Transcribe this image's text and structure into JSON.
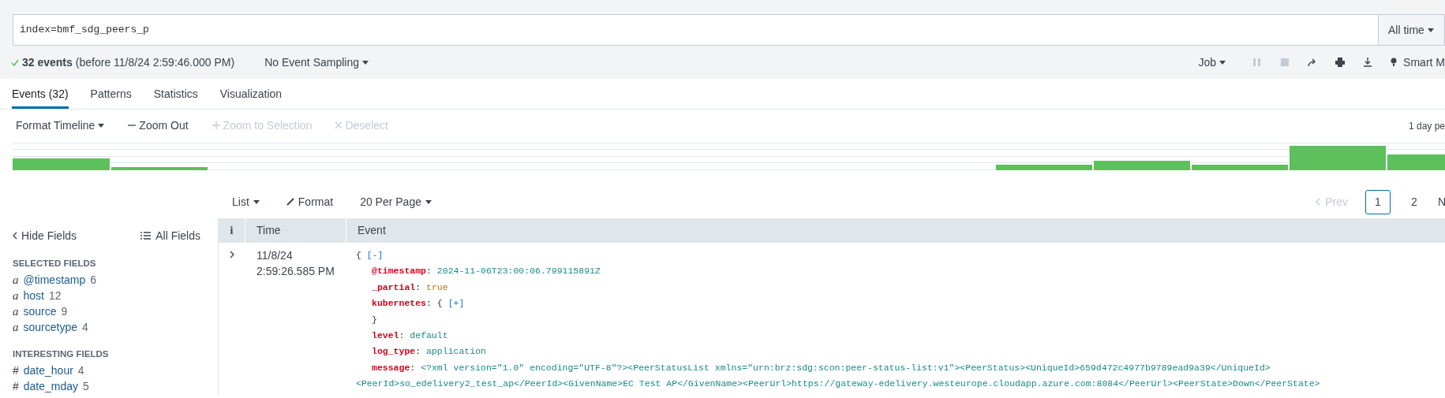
{
  "search": {
    "query": "index=bmf_sdg_peers_p",
    "time_range": "All time"
  },
  "status": {
    "count": "32 events",
    "detail": "(before 11/8/24 2:59:46.000 PM)",
    "sampling": "No Event Sampling"
  },
  "job_toolbar": {
    "job": "Job",
    "controls": [
      {
        "kind": "pause",
        "disabled": true
      },
      {
        "kind": "stop",
        "disabled": true
      },
      {
        "kind": "share",
        "disabled": false
      },
      {
        "kind": "print",
        "disabled": false
      },
      {
        "kind": "export",
        "disabled": false
      }
    ],
    "mode": "Smart M"
  },
  "tabs": [
    {
      "label": "Events (32)",
      "selected": true
    },
    {
      "label": "Patterns",
      "selected": false
    },
    {
      "label": "Statistics",
      "selected": false
    },
    {
      "label": "Visualization",
      "selected": false
    }
  ],
  "timeline_toolbar": [
    {
      "kind": "menu",
      "label": "Format Timeline",
      "disabled": false
    },
    {
      "kind": "minus",
      "label": "Zoom Out",
      "disabled": false
    },
    {
      "kind": "plus",
      "label": "Zoom to Selection",
      "disabled": true
    },
    {
      "kind": "x",
      "label": "Deselect",
      "disabled": true
    }
  ],
  "timeline": {
    "scale_label": "1 day pe"
  },
  "results_toolbar": [
    {
      "kind": "menu",
      "label": "List"
    },
    {
      "kind": "brush",
      "label": "Format"
    },
    {
      "kind": "menu",
      "label": "20 Per Page"
    }
  ],
  "pagination": {
    "prev": {
      "label": "Prev",
      "disabled": true
    },
    "pages": [
      {
        "label": "1",
        "selected": true
      },
      {
        "label": "2",
        "selected": false
      }
    ],
    "next": "N"
  },
  "sidebar": {
    "hide": "Hide Fields",
    "all": "All Fields",
    "groups": [
      {
        "title": "SELECTED FIELDS",
        "fields": [
          {
            "type": "a",
            "name": "@timestamp",
            "count": "6"
          },
          {
            "type": "a",
            "name": "host",
            "count": "12"
          },
          {
            "type": "a",
            "name": "source",
            "count": "9"
          },
          {
            "type": "a",
            "name": "sourcetype",
            "count": "4"
          }
        ]
      },
      {
        "title": "INTERESTING FIELDS",
        "fields": [
          {
            "type": "#",
            "name": "date_hour",
            "count": "4"
          },
          {
            "type": "#",
            "name": "date_mday",
            "count": "5"
          }
        ]
      }
    ]
  },
  "table": {
    "columns": [
      "i",
      "Time",
      "Event"
    ],
    "rows": [
      {
        "expanded": false,
        "time": [
          "11/8/24",
          "2:59:26.585 PM"
        ],
        "lines": [
          {
            "kind": "open",
            "text": "{",
            "toggle": "[-]"
          },
          {
            "kind": "field",
            "key": "@timestamp",
            "sep": ":",
            "value": "2024-11-06T23:00:06.799115891Z"
          },
          {
            "kind": "boolean",
            "key": "_partial",
            "sep": ":",
            "value": "true"
          },
          {
            "kind": "object",
            "key": "kubernetes",
            "sep": ":",
            "text": "{",
            "toggle": "[+]"
          },
          {
            "kind": "close",
            "text": "}"
          },
          {
            "kind": "field",
            "key": "level",
            "sep": ":",
            "value": "default"
          },
          {
            "kind": "field",
            "key": "log_type",
            "sep": ":",
            "value": "application"
          },
          {
            "kind": "field",
            "key": "message",
            "sep": ":",
            "value": "<?xml version=\"1.0\" encoding=\"UTF-8\"?><PeerStatusList xmlns=\"urn:brz:sdg:scon:peer-status-list:v1\"><PeerStatus><UniqueId>659d472c4977b9789ead9a39</UniqueId>"
          },
          {
            "kind": "wrap",
            "text": "<PeerId>so_edelivery2_test_ap</PeerId><GivenName>EC Test AP</GivenName><PeerUrl>https://gateway-edelivery.westeurope.cloudapp.azure.com:8084</PeerUrl><PeerState>Down</PeerState>"
          }
        ]
      }
    ]
  }
}
